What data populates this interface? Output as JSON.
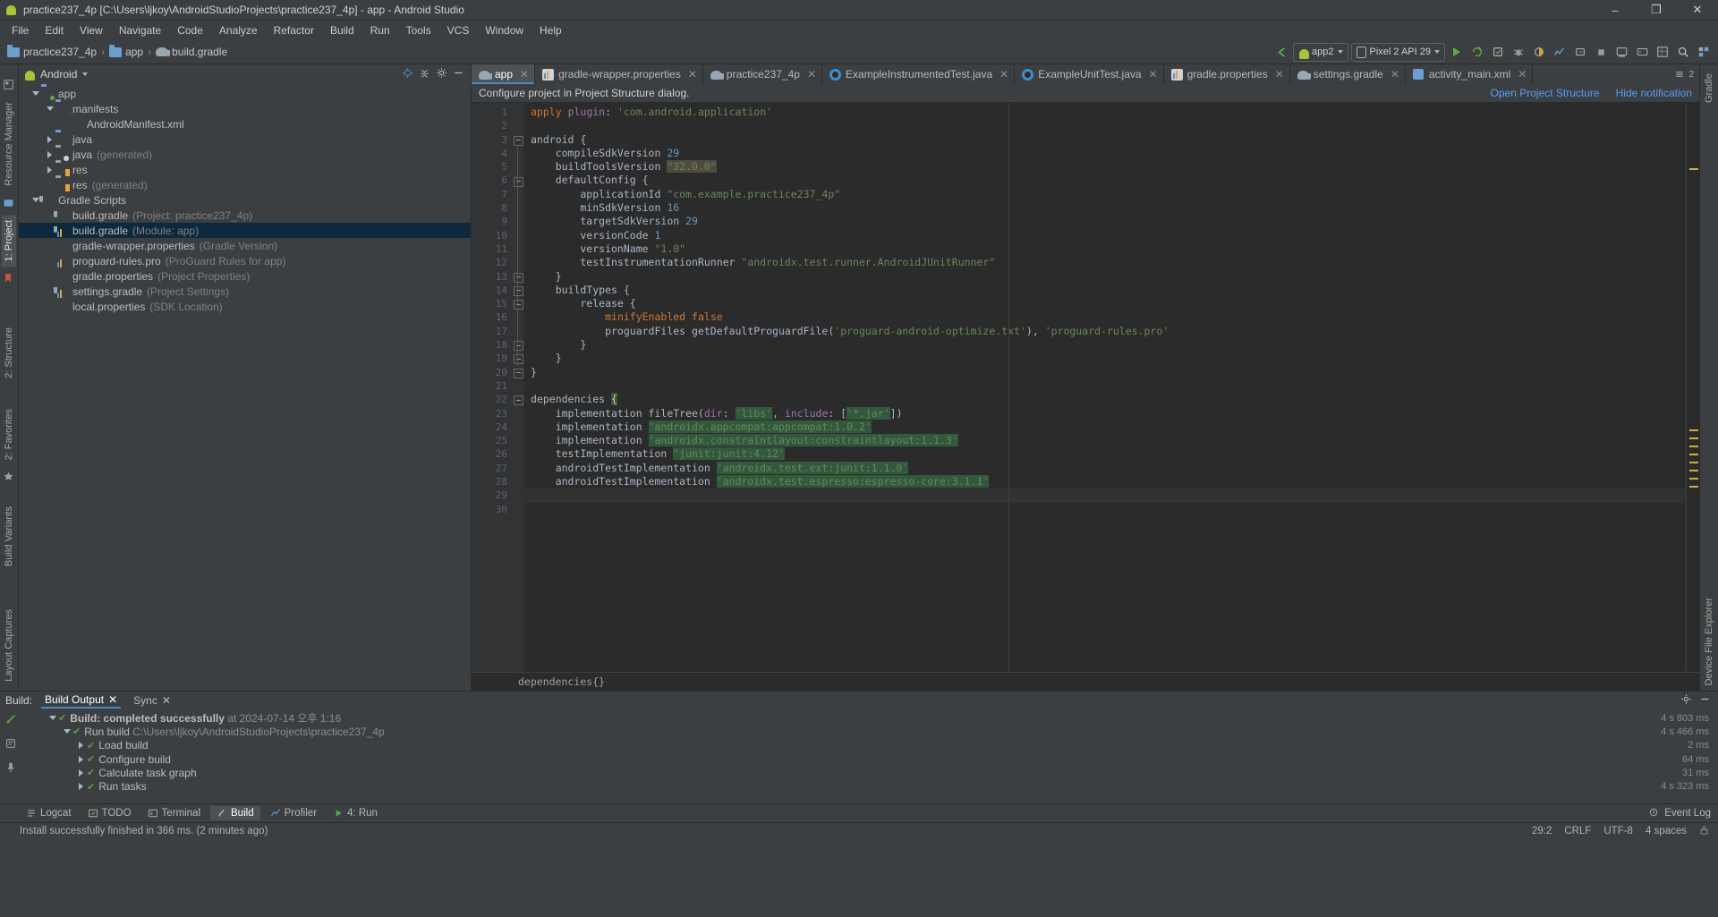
{
  "window": {
    "title": "practice237_4p [C:\\Users\\ljkoy\\AndroidStudioProjects\\practice237_4p] - app - Android Studio",
    "minimize": "–",
    "maximize": "❐",
    "close": "✕"
  },
  "menu": [
    "File",
    "Edit",
    "View",
    "Navigate",
    "Code",
    "Analyze",
    "Refactor",
    "Build",
    "Run",
    "Tools",
    "VCS",
    "Window",
    "Help"
  ],
  "breadcrumb": [
    "practice237_4p",
    "app",
    "build.gradle"
  ],
  "toolbar": {
    "run_config": "app2",
    "device": "Pixel 2 API 29"
  },
  "project_panel": {
    "selector": "Android",
    "tree": [
      {
        "indent": 0,
        "twisty": "down",
        "icon": "folder-module",
        "label": "app",
        "sub": ""
      },
      {
        "indent": 1,
        "twisty": "down",
        "icon": "folder",
        "label": "manifests",
        "sub": ""
      },
      {
        "indent": 2,
        "twisty": "none",
        "icon": "manifest",
        "label": "AndroidManifest.xml",
        "sub": ""
      },
      {
        "indent": 1,
        "twisty": "right",
        "icon": "folder",
        "label": "java",
        "sub": ""
      },
      {
        "indent": 1,
        "twisty": "right",
        "icon": "folder-gen",
        "label": "java",
        "sub": "(generated)"
      },
      {
        "indent": 1,
        "twisty": "right",
        "icon": "folder-res",
        "label": "res",
        "sub": ""
      },
      {
        "indent": 1,
        "twisty": "none",
        "icon": "folder-res",
        "label": "res",
        "sub": "(generated)"
      },
      {
        "indent": 0,
        "twisty": "down",
        "icon": "gradle",
        "label": "Gradle Scripts",
        "sub": ""
      },
      {
        "indent": 1,
        "twisty": "none",
        "icon": "gradle",
        "label": "build.gradle",
        "sub": "(Project: practice237_4p)"
      },
      {
        "indent": 1,
        "twisty": "none",
        "icon": "gradle",
        "label": "build.gradle",
        "sub": "(Module: app)",
        "selected": true
      },
      {
        "indent": 1,
        "twisty": "none",
        "icon": "props",
        "label": "gradle-wrapper.properties",
        "sub": "(Gradle Version)"
      },
      {
        "indent": 1,
        "twisty": "none",
        "icon": "doc",
        "label": "proguard-rules.pro",
        "sub": "(ProGuard Rules for app)"
      },
      {
        "indent": 1,
        "twisty": "none",
        "icon": "props",
        "label": "gradle.properties",
        "sub": "(Project Properties)"
      },
      {
        "indent": 1,
        "twisty": "none",
        "icon": "gradle",
        "label": "settings.gradle",
        "sub": "(Project Settings)"
      },
      {
        "indent": 1,
        "twisty": "none",
        "icon": "props",
        "label": "local.properties",
        "sub": "(SDK Location)"
      }
    ]
  },
  "editor_tabs": [
    {
      "label": "app",
      "icon": "gradle",
      "active": true
    },
    {
      "label": "gradle-wrapper.properties",
      "icon": "props",
      "active": false
    },
    {
      "label": "practice237_4p",
      "icon": "gradle",
      "active": false
    },
    {
      "label": "ExampleInstrumentedTest.java",
      "icon": "java",
      "active": false
    },
    {
      "label": "ExampleUnitTest.java",
      "icon": "java",
      "active": false
    },
    {
      "label": "gradle.properties",
      "icon": "props",
      "active": false
    },
    {
      "label": "settings.gradle",
      "icon": "gradle",
      "active": false
    },
    {
      "label": "activity_main.xml",
      "icon": "xml",
      "active": false
    }
  ],
  "notification": {
    "text": "Configure project in Project Structure dialog.",
    "link_open": "Open Project Structure",
    "link_hide": "Hide notification"
  },
  "code": {
    "lines": [
      "apply plugin: 'com.android.application'",
      "",
      "android {",
      "    compileSdkVersion 29",
      "    buildToolsVersion \"32.0.0\"",
      "    defaultConfig {",
      "        applicationId \"com.example.practice237_4p\"",
      "        minSdkVersion 16",
      "        targetSdkVersion 29",
      "        versionCode 1",
      "        versionName \"1.0\"",
      "        testInstrumentationRunner \"androidx.test.runner.AndroidJUnitRunner\"",
      "    }",
      "    buildTypes {",
      "        release {",
      "            minifyEnabled false",
      "            proguardFiles getDefaultProguardFile('proguard-android-optimize.txt'), 'proguard-rules.pro'",
      "        }",
      "    }",
      "}",
      "",
      "dependencies {",
      "    implementation fileTree(dir: 'libs', include: ['*.jar'])",
      "    implementation 'androidx.appcompat:appcompat:1.0.2'",
      "    implementation 'androidx.constraintlayout:constraintlayout:1.1.3'",
      "    testImplementation 'junit:junit:4.12'",
      "    androidTestImplementation 'androidx.test.ext:junit:1.1.0'",
      "    androidTestImplementation 'androidx.test.espresso:espresso-core:3.1.1'",
      "}",
      ""
    ],
    "total_lines": 30,
    "status_breadcrumb": "dependencies{}"
  },
  "build_panel": {
    "title": "Build:",
    "tabs": [
      {
        "label": "Build Output",
        "active": true
      },
      {
        "label": "Sync",
        "active": false
      }
    ],
    "rows": [
      {
        "indent": 0,
        "label": "Build:",
        "suffix": "completed successfully",
        "detail": "at 2024-07-14 오후 1:16",
        "time": "4 s 803 ms",
        "check": true,
        "twisty": "down"
      },
      {
        "indent": 1,
        "label": "Run build",
        "suffix": "",
        "detail": "C:\\Users\\ljkoy\\AndroidStudioProjects\\practice237_4p",
        "time": "4 s 466 ms",
        "check": true,
        "twisty": "down"
      },
      {
        "indent": 2,
        "label": "Load build",
        "suffix": "",
        "detail": "",
        "time": "2 ms",
        "check": true,
        "twisty": "right"
      },
      {
        "indent": 2,
        "label": "Configure build",
        "suffix": "",
        "detail": "",
        "time": "64 ms",
        "check": true,
        "twisty": "right"
      },
      {
        "indent": 2,
        "label": "Calculate task graph",
        "suffix": "",
        "detail": "",
        "time": "31 ms",
        "check": true,
        "twisty": "right"
      },
      {
        "indent": 2,
        "label": "Run tasks",
        "suffix": "",
        "detail": "",
        "time": "4 s 323 ms",
        "check": true,
        "twisty": "right"
      }
    ]
  },
  "bottom_tabs": [
    {
      "label": "Logcat",
      "icon": "logcat",
      "active": false
    },
    {
      "label": "TODO",
      "icon": "todo",
      "active": false
    },
    {
      "label": "Terminal",
      "icon": "terminal",
      "active": false
    },
    {
      "label": "Build",
      "icon": "build",
      "active": true
    },
    {
      "label": "Profiler",
      "icon": "profiler",
      "active": false
    },
    {
      "label": "Run",
      "icon": "run",
      "active": false
    }
  ],
  "bottom_right": {
    "label": "Event Log"
  },
  "status_bar": {
    "message": "Install successfully finished in 366 ms. (2 minutes ago)",
    "caret": "29:2",
    "line_sep": "CRLF",
    "encoding": "UTF-8",
    "indent": "4 spaces"
  },
  "left_rail": [
    "1: Project",
    "2: Structure",
    "2: Favorites",
    "Build Variants",
    "Layout Captures"
  ],
  "right_rail": [
    "Gradle",
    "Device File Explorer"
  ]
}
